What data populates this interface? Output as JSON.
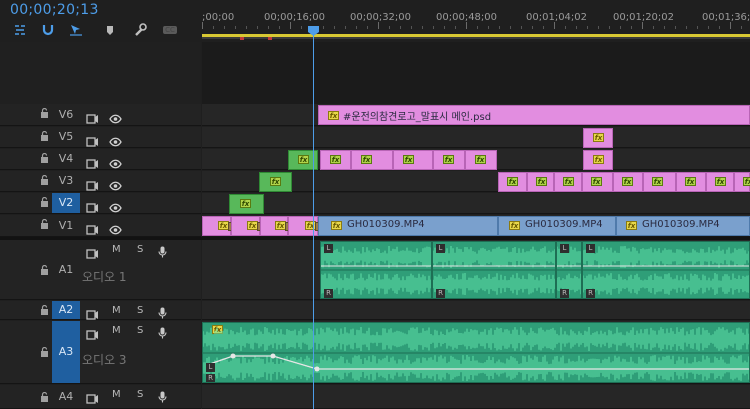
{
  "timecode": "00;00;20;13",
  "toolbar": {
    "snap": "snap-icon",
    "linked": "linked-selection-icon",
    "markers": "add-marker-icon",
    "settings": "wrench-icon",
    "captions": "CC"
  },
  "ruler": {
    "labels": [
      ";00;00",
      "00;00;16;00",
      "00;00;32;00",
      "00;00;48;00",
      "00;01;04;02",
      "00;01;20;02",
      "00;01;36;0"
    ]
  },
  "video_tracks": [
    {
      "name": "V6",
      "active": false
    },
    {
      "name": "V5",
      "active": false
    },
    {
      "name": "V4",
      "active": false
    },
    {
      "name": "V3",
      "active": false
    },
    {
      "name": "V2",
      "active": true
    },
    {
      "name": "V1",
      "active": false
    }
  ],
  "audio_tracks": [
    {
      "name": "A1",
      "label": "오디오 1",
      "mute": "M",
      "solo": "S",
      "active": false
    },
    {
      "name": "A2",
      "label": "",
      "mute": "M",
      "solo": "S",
      "active": true
    },
    {
      "name": "A3",
      "label": "오디오 3",
      "mute": "M",
      "solo": "S",
      "active": true
    },
    {
      "name": "A4",
      "label": "",
      "mute": "M",
      "solo": "S",
      "active": false
    }
  ],
  "clips": {
    "v6_title": "#운전의참견로고_말표시 메인.psd",
    "v1_a": "GH010309.MP4",
    "v1_b": "GH010309.MP4",
    "v1_c": "GH010309.MP4",
    "fx": "fx"
  },
  "colors": {
    "accent": "#4d9de9",
    "graphic_clip": "#e28de0",
    "adjust_clip": "#58b85a",
    "video_clip": "#7aa0cd",
    "audio_clip": "#2f9e78",
    "work_area": "#d8c833"
  }
}
